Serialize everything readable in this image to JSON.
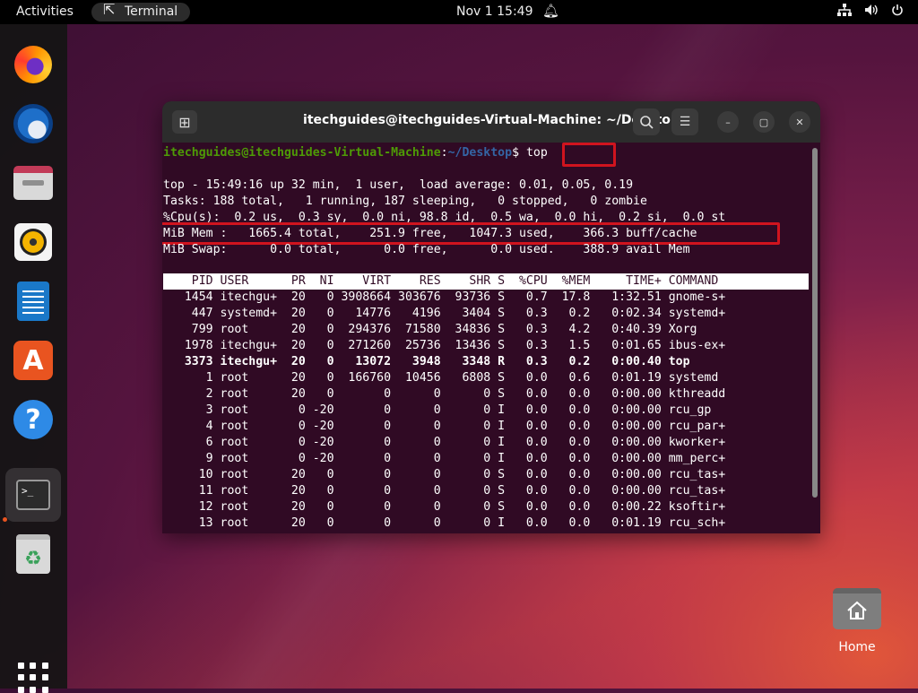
{
  "topbar": {
    "activities": "Activities",
    "app_name": "Terminal",
    "date_time": "Nov 1  15:49"
  },
  "dock": {
    "items": [
      "firefox",
      "thunderbird",
      "files",
      "rhythmbox",
      "libreoffice-writer",
      "ubuntu-software",
      "help",
      "terminal",
      "trash"
    ],
    "active": "terminal",
    "show_apps": "show-applications"
  },
  "terminal": {
    "title": "itechguides@itechguides-Virtual-Machine: ~/Desktop",
    "prompt_user": "itechguides@itechguides-Virtual-Machine",
    "prompt_sep": ":",
    "prompt_path": "~/Desktop",
    "prompt_dollar": "$ ",
    "command": "top",
    "summary": [
      "top - 15:49:16 up 32 min,  1 user,  load average: 0.01, 0.05, 0.19",
      "Tasks: 188 total,   1 running, 187 sleeping,   0 stopped,   0 zombie",
      "%Cpu(s):  0.2 us,  0.3 sy,  0.0 ni, 98.8 id,  0.5 wa,  0.0 hi,  0.2 si,  0.0 st",
      "MiB Mem :   1665.4 total,    251.9 free,   1047.3 used,    366.3 buff/cache",
      "MiB Swap:      0.0 total,      0.0 free,      0.0 used.    388.9 avail Mem"
    ],
    "table_header": "    PID USER      PR  NI    VIRT    RES    SHR S  %CPU  %MEM     TIME+ COMMAND",
    "rows": [
      "   1454 itechgu+  20   0 3908664 303676  93736 S   0.7  17.8   1:32.51 gnome-s+",
      "    447 systemd+  20   0   14776   4196   3404 S   0.3   0.2   0:02.34 systemd+",
      "    799 root      20   0  294376  71580  34836 S   0.3   4.2   0:40.39 Xorg",
      "   1978 itechgu+  20   0  271260  25736  13436 S   0.3   1.5   0:01.65 ibus-ex+",
      "   3373 itechgu+  20   0   13072   3948   3348 R   0.3   0.2   0:00.40 top",
      "      1 root      20   0  166760  10456   6808 S   0.0   0.6   0:01.19 systemd",
      "      2 root      20   0       0      0      0 S   0.0   0.0   0:00.00 kthreadd",
      "      3 root       0 -20       0      0      0 I   0.0   0.0   0:00.00 rcu_gp",
      "      4 root       0 -20       0      0      0 I   0.0   0.0   0:00.00 rcu_par+",
      "      6 root       0 -20       0      0      0 I   0.0   0.0   0:00.00 kworker+",
      "      9 root       0 -20       0      0      0 I   0.0   0.0   0:00.00 mm_perc+",
      "     10 root      20   0       0      0      0 S   0.0   0.0   0:00.00 rcu_tas+",
      "     11 root      20   0       0      0      0 S   0.0   0.0   0:00.00 rcu_tas+",
      "     12 root      20   0       0      0      0 S   0.0   0.0   0:00.22 ksoftir+",
      "     13 root      20   0       0      0      0 I   0.0   0.0   0:01.19 rcu_sch+"
    ]
  },
  "desktop": {
    "home_label": "Home"
  }
}
